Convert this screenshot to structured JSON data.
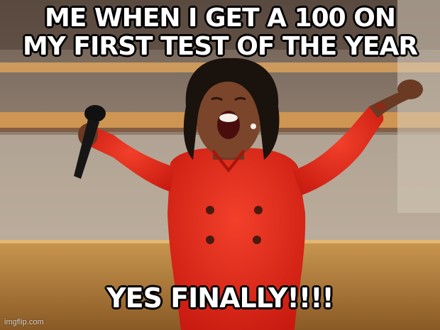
{
  "meme": {
    "top_text_line1": "ME WHEN I GET A 100 ON",
    "top_text_line2": "MY FIRST TEST OF THE YEAR",
    "bottom_text": "YES FINALLY!!!!",
    "watermark": "imgflip.com"
  },
  "colors": {
    "outfit_red": "#e8261b",
    "stage_wood": "#c8964f",
    "caption_text": "#ffffff",
    "caption_outline": "#000000"
  }
}
